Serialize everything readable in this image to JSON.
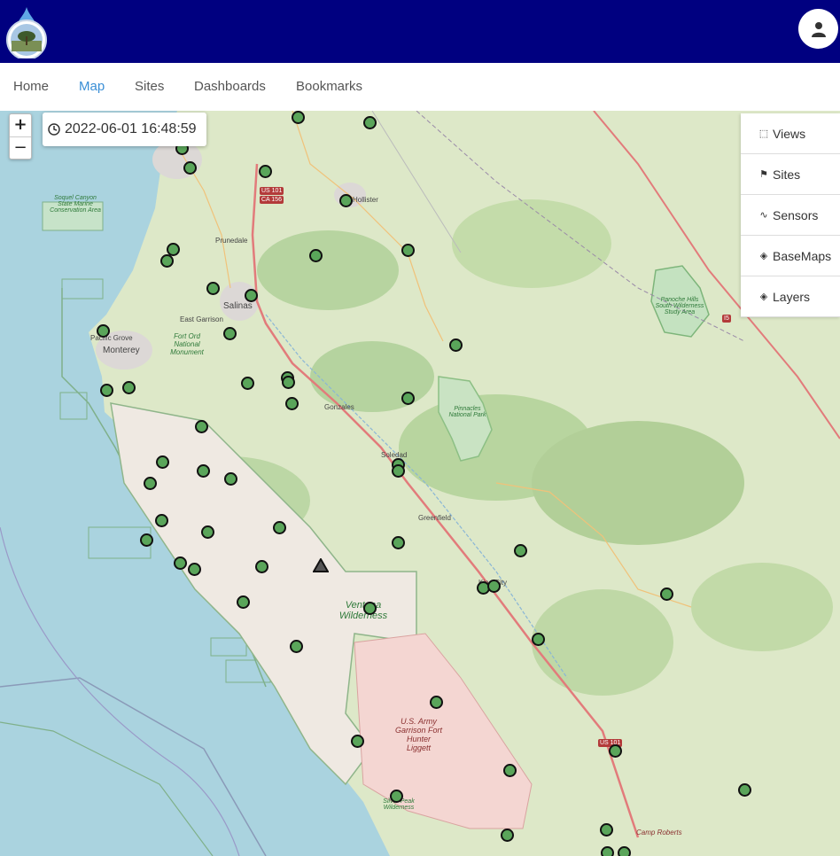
{
  "header": {
    "logo_icon": "water-drop-logo-icon",
    "user_icon": "user-icon"
  },
  "nav": {
    "items": [
      {
        "label": "Home",
        "active": false
      },
      {
        "label": "Map",
        "active": true
      },
      {
        "label": "Sites",
        "active": false
      },
      {
        "label": "Dashboards",
        "active": false
      },
      {
        "label": "Bookmarks",
        "active": false
      }
    ]
  },
  "map": {
    "zoom_in": "+",
    "zoom_out": "−",
    "timestamp": "2022-06-01 16:48:59",
    "timestamp_icon": "clock-icon",
    "panel": [
      {
        "label": "Views",
        "icon": "square-dashed-icon"
      },
      {
        "label": "Sites",
        "icon": "flag-icon"
      },
      {
        "label": "Sensors",
        "icon": "pulse-icon"
      },
      {
        "label": "BaseMaps",
        "icon": "layers-icon"
      },
      {
        "label": "Layers",
        "icon": "layers-icon"
      }
    ],
    "labels": {
      "salinas": "Salinas",
      "monterey": "Monterey",
      "pacific_grove": "Pacific Grove",
      "east_garrison": "East Garrison",
      "prunedale": "Prunedale",
      "hollister": "Hollister",
      "gonzales": "Gonzales",
      "soledad": "Soledad",
      "greenfield": "Greenfield",
      "king_city": "King City",
      "fort_ord": "Fort Ord National Monument",
      "soquel": "Soquel Canyon State Marine Conservation Area",
      "pinnacles": "Pinnacles National Park",
      "panoche": "Panoche Hills South Wilderness Study Area",
      "ventana": "Ventana Wilderness",
      "fort_hunter": "U.S. Army Garrison Fort Hunter Liggett",
      "silver_peak": "Silver Peak Wilderness",
      "camp_roberts": "Camp Roberts",
      "us101": "US 101",
      "ca156": "CA 156",
      "i5": "I5"
    },
    "site_count": 70,
    "marker_color": "#5aa55a"
  }
}
